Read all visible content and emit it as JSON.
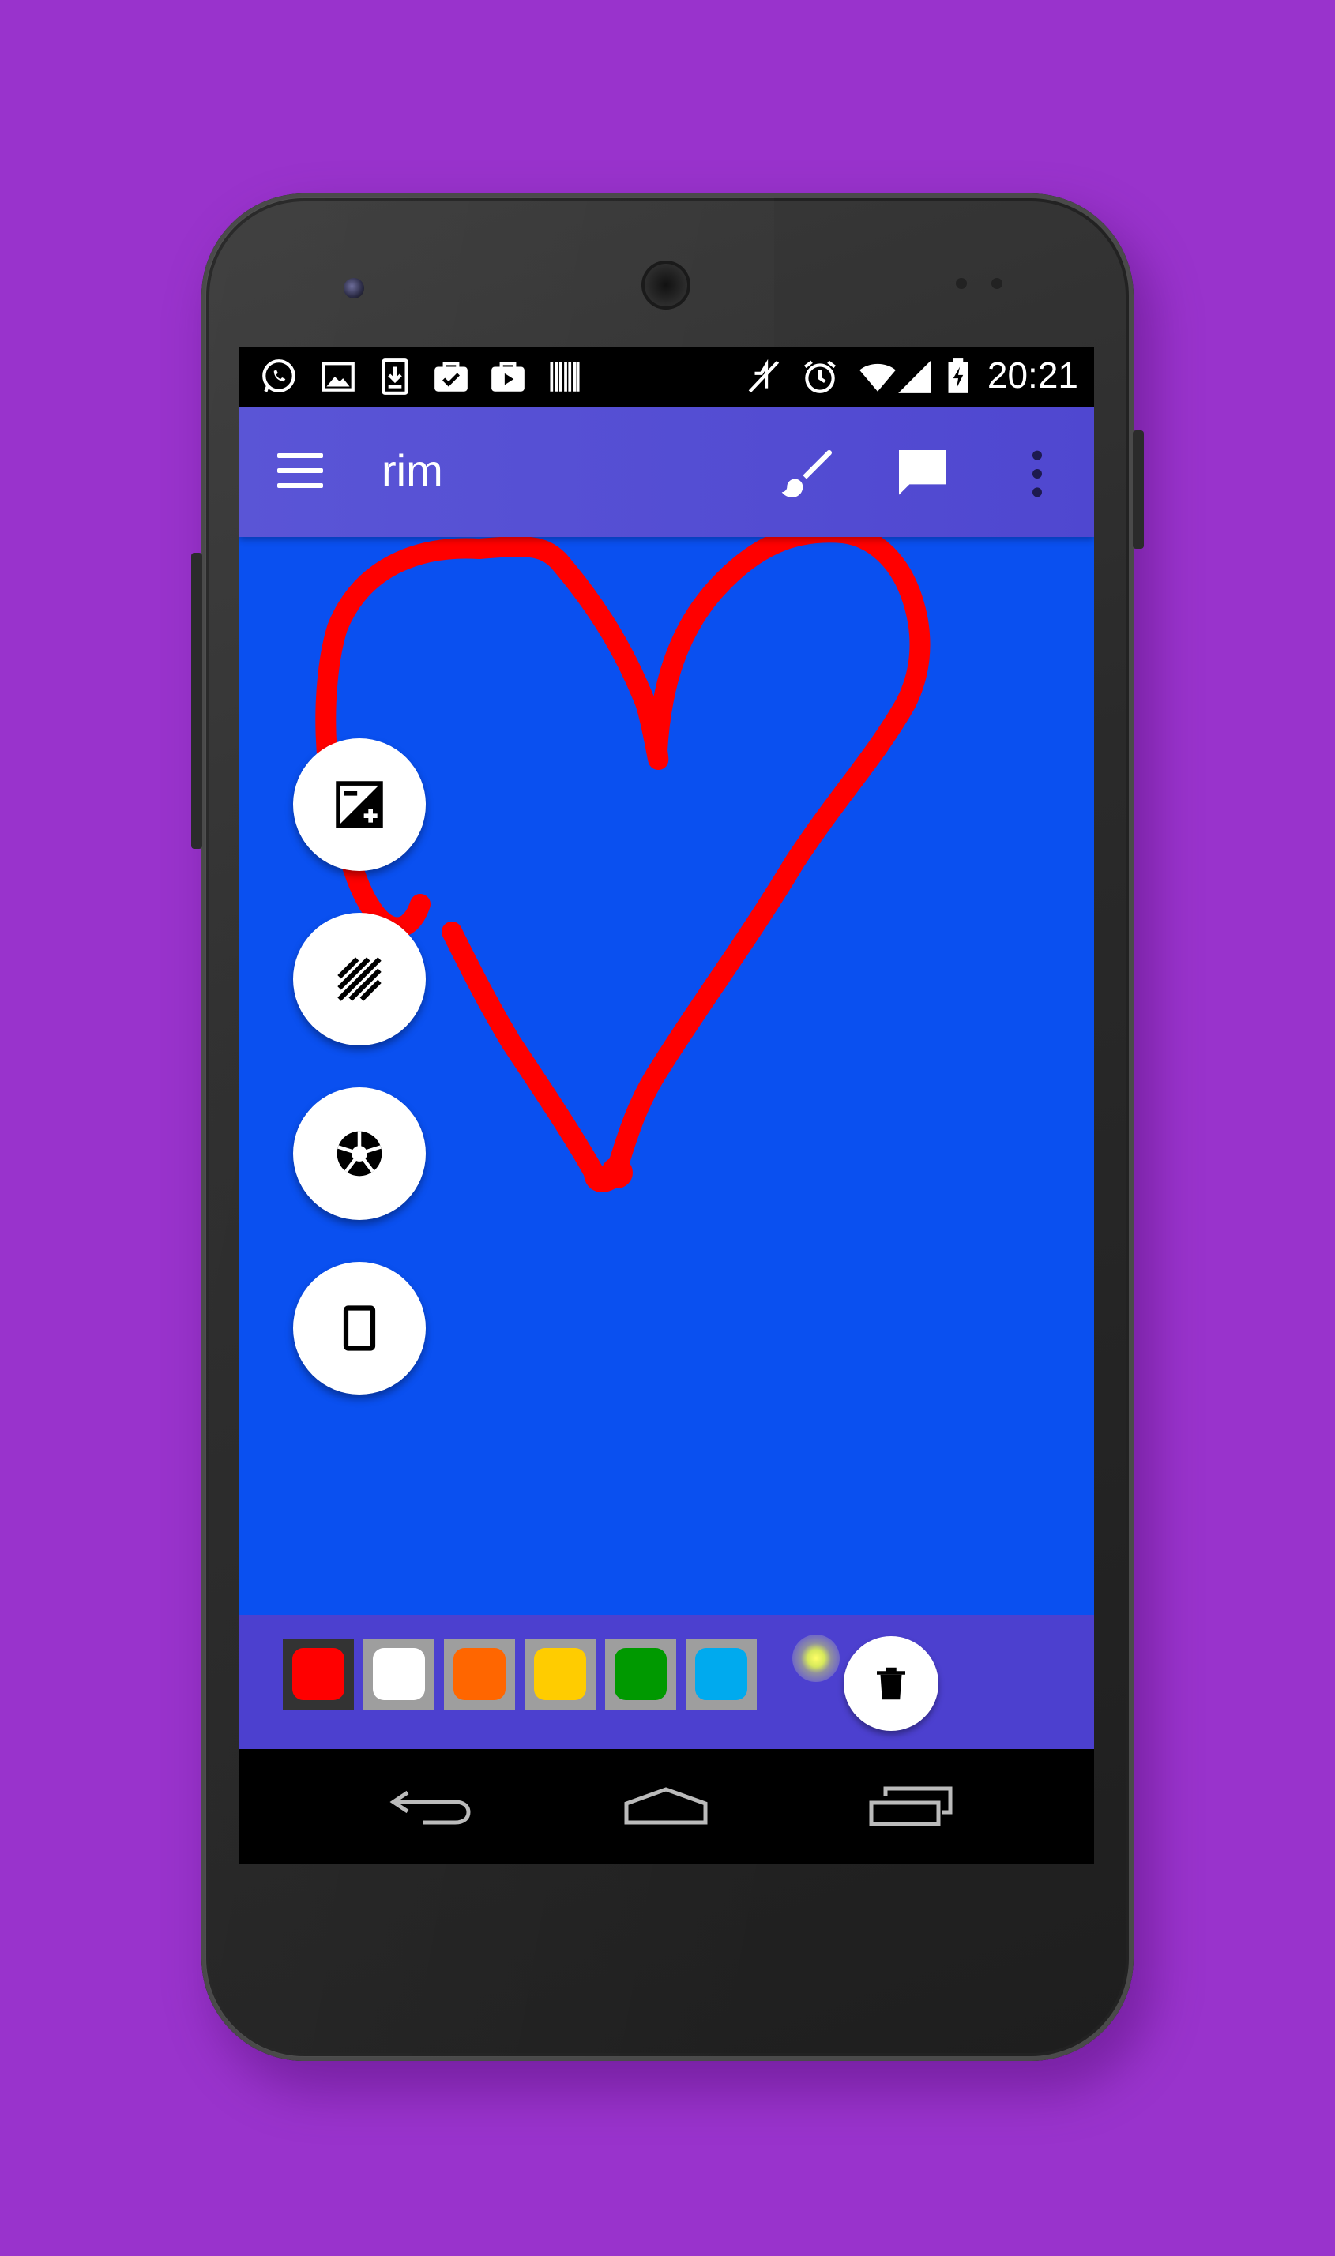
{
  "statusbar": {
    "time": "20:21",
    "left_icons": [
      "whatsapp-icon",
      "gallery-icon",
      "download-icon",
      "briefcase-check-icon",
      "media-icon",
      "barcode-icon"
    ],
    "right_icons": [
      "mute-icon",
      "alarm-icon",
      "wifi-icon",
      "signal-icon",
      "battery-charging-icon"
    ]
  },
  "appbar": {
    "title": "rim",
    "actions": [
      "brush-icon",
      "comment-icon",
      "more-vert-icon"
    ]
  },
  "canvas": {
    "background": "#0a50f0",
    "stroke_color": "#ff0000",
    "tools": [
      "exposure-icon",
      "texture-icon",
      "camera-aperture-icon",
      "tablet-icon"
    ]
  },
  "palette": {
    "selected": "red",
    "colors": [
      {
        "name": "red",
        "hex": "#ff0000"
      },
      {
        "name": "white",
        "hex": "#ffffff"
      },
      {
        "name": "orange",
        "hex": "#ff6600"
      },
      {
        "name": "yellow",
        "hex": "#ffcc00"
      },
      {
        "name": "green",
        "hex": "#009900"
      },
      {
        "name": "light-blue",
        "hex": "#00aaee"
      }
    ]
  },
  "navbar": {
    "buttons": [
      "back-icon",
      "home-icon",
      "recents-icon"
    ]
  },
  "theme": {
    "background": "#9933cc",
    "appbar": "#5a55d6",
    "bottombar": "#4c40cf"
  }
}
